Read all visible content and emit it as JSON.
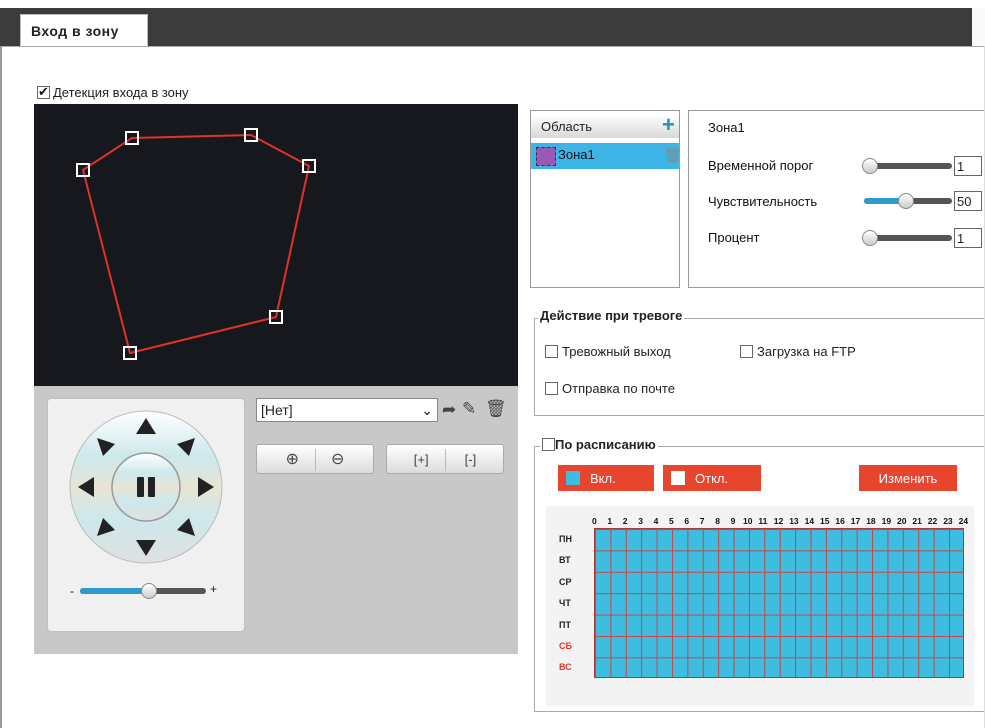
{
  "tab": {
    "label": "Вход в зону"
  },
  "detection": {
    "label": "Детекция входа в зону",
    "checked": true
  },
  "preset": {
    "selected": "[Нет]"
  },
  "area": {
    "header": "Область",
    "items": [
      {
        "label": "Зона1",
        "color": "#9b59b6"
      }
    ]
  },
  "props": {
    "zone_name": "Зона1",
    "time_threshold": {
      "label": "Временной порог",
      "value": "1"
    },
    "sensitivity": {
      "label": "Чувствительность",
      "value": "50"
    },
    "percent": {
      "label": "Процент",
      "value": "1"
    }
  },
  "alarm": {
    "title": "Действие при тревоге",
    "options": {
      "alarm_out": "Тревожный выход",
      "ftp": "Загрузка на FTP",
      "email": "Отправка по почте"
    }
  },
  "schedule": {
    "title": "По расписанию",
    "on_label": "Вкл.",
    "off_label": "Откл.",
    "edit_label": "Изменить",
    "on_color": "#3dbde0",
    "off_color": "#ffffff",
    "hours": [
      "0",
      "1",
      "2",
      "3",
      "4",
      "5",
      "6",
      "7",
      "8",
      "9",
      "10",
      "11",
      "12",
      "13",
      "14",
      "15",
      "16",
      "17",
      "18",
      "19",
      "20",
      "21",
      "22",
      "23",
      "24"
    ],
    "days": [
      "ПН",
      "ВТ",
      "СР",
      "ЧТ",
      "ПТ",
      "СБ",
      "ВС"
    ]
  },
  "zoom_slider": {
    "minus": "-",
    "plus": "+",
    "level": 0.55
  }
}
